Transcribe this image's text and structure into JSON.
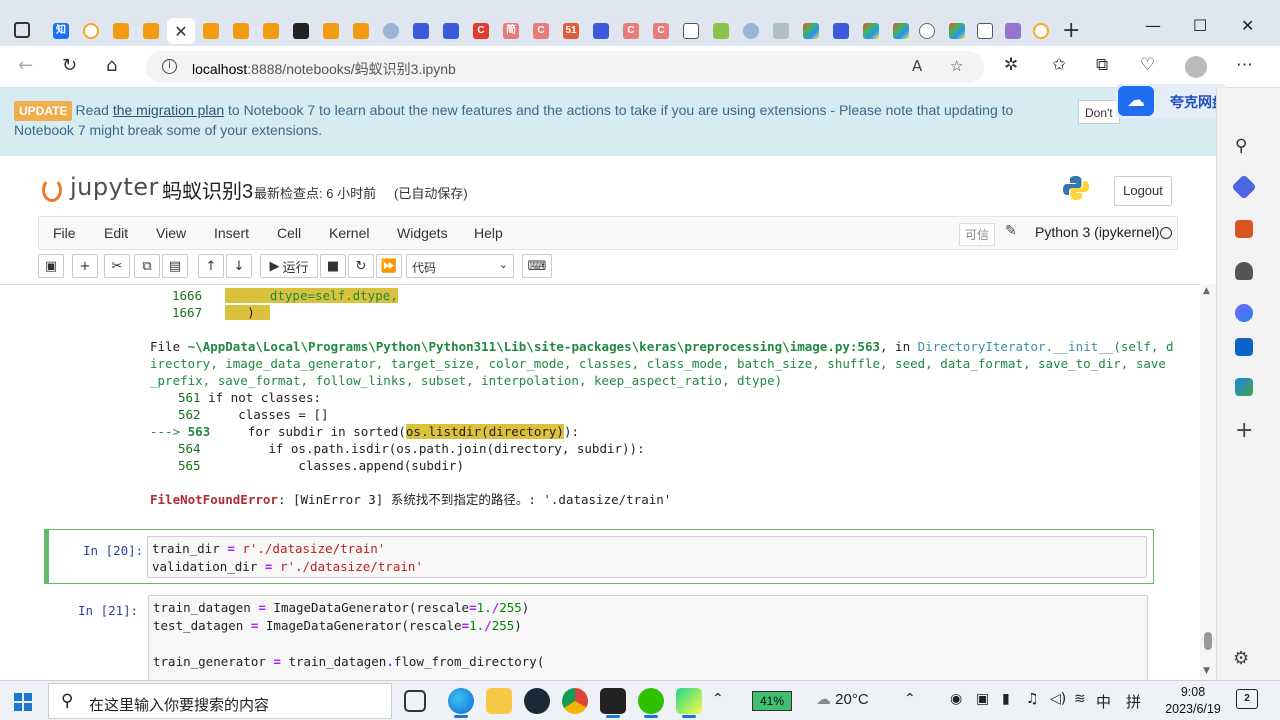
{
  "browser": {
    "tabs_icons": [
      "zhihu-tab",
      "colab-tab",
      "doc-tab",
      "doc-tab",
      "jupyter-tab-active",
      "doc-tab",
      "doc-tab",
      "doc-tab",
      "crown-tab",
      "doc-tab",
      "doc-tab",
      "search-tab",
      "baidu-tab",
      "baidu-tab",
      "csdn-tab",
      "csdn-tab",
      "csdn-tab",
      "csdn-tab",
      "51cto-tab",
      "baidu-tab",
      "csdn-tab",
      "csdn-tab",
      "window-tab",
      "chart-tab",
      "search-tab",
      "dots-tab",
      "color-tab",
      "baidu-tab",
      "color-tab",
      "color-tab",
      "gear-tab",
      "color-tab",
      "window-tab",
      "shield-tab",
      "colab-tab"
    ],
    "tab_zhihu_label": "知",
    "tab_csdn_label": "C",
    "tab_jian_label": "简",
    "tab_51_label": "51",
    "url_host": "localhost",
    "url_port_path": ":8888/notebooks/蚂蚁识别3.ipynb",
    "read_aloud": "A",
    "close_glyph": "✕"
  },
  "banner": {
    "badge": "UPDATE",
    "text_before": "Read ",
    "link": "the migration plan",
    "text_after": " to Notebook 7 to learn about the new features and the actions to take if you are using extensions - Please note that updating to Notebook 7 might break some of your extensions.",
    "dont_button": "Don't"
  },
  "quark": {
    "label": "夸克网盘"
  },
  "jupyter": {
    "logo_text": "jupyter",
    "notebook_name": "蚂蚁识别3",
    "checkpoint": "最新检查点: 6 小时前",
    "autosave": "(已自动保存)",
    "logout": "Logout",
    "menu": [
      "File",
      "Edit",
      "View",
      "Insert",
      "Cell",
      "Kernel",
      "Widgets",
      "Help"
    ],
    "trusted": "可信",
    "kernel": "Python 3 (ipykernel)",
    "run_label": "运行",
    "cell_type": "代码"
  },
  "traceback": {
    "line_1666_num": "1666",
    "line_1666_code": "dtype=self.dtype,",
    "line_1667_num": "1667",
    "line_1667_code": ")",
    "file_prefix": "File ",
    "file_path": "~\\AppData\\Local\\Programs\\Python\\Python311\\Lib\\site-packages\\keras\\preprocessing\\image.py:563",
    "in_word": ", in ",
    "func_name": "DirectoryIterator.__init__",
    "sig_1": "(self, d",
    "sig_2": "irectory, image_data_generator, target_size, color_mode, classes, class_mode, batch_size, shuffle, seed, data_format, save_to_dir, save",
    "sig_3": "_prefix, save_format, follow_links, subset, interpolation, keep_aspect_ratio, dtype)",
    "l561": "561",
    "l562": "562",
    "l563": "563",
    "l564": "564",
    "l565": "565",
    "arrow": "---> ",
    "c561": "if not classes:",
    "c562": "    classes = []",
    "c563_pre": "    for subdir in sorted(",
    "c563_hl": "os.listdir(directory)",
    "c563_post": "):",
    "c564": "        if os.path.isdir(os.path.join(directory, subdir)):",
    "c565": "            classes.append(subdir)",
    "error_name": "FileNotFoundError",
    "error_msg": ": [WinError 3] 系统找不到指定的路径。: '.datasize/train'"
  },
  "cells": [
    {
      "prompt": "In  [20]:",
      "lines": [
        "train_dir = r'./datasize/train'",
        "validation_dir = r'./datasize/train'"
      ]
    },
    {
      "prompt": "In  [21]:",
      "lines": [
        "train_datagen = ImageDataGenerator(rescale=1./255)",
        "test_datagen = ImageDataGenerator(rescale=1./255)",
        "",
        "train_generator = train_datagen.flow_from_directory("
      ]
    }
  ],
  "taskbar": {
    "search_placeholder": "在这里输入你要搜索的内容",
    "battery": "41%",
    "weather": "20°C",
    "ime": "中",
    "ime2": "拼",
    "time": "9:08",
    "date": "2023/6/19",
    "notifications": "2"
  },
  "colors": {
    "accent_jupyter": "#f37726",
    "highlight": "#dbc23c",
    "selected_cell": "#66bb6a",
    "banner_bg": "#d7ebf3",
    "update_badge": "#f0ad4e"
  }
}
